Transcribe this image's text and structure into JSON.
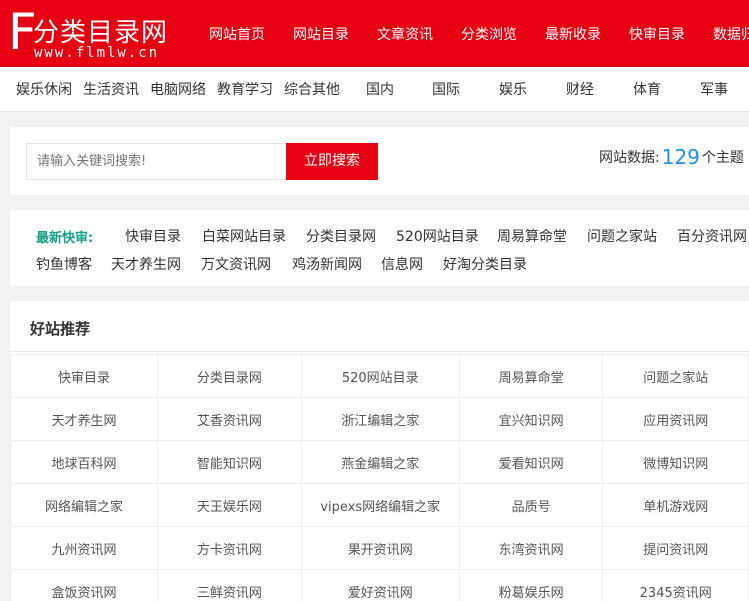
{
  "header": {
    "logo_letter": "F",
    "logo_title": "分类目录网",
    "logo_url": "www.flmlw.cn",
    "nav": [
      "网站首页",
      "网站目录",
      "文章资讯",
      "分类浏览",
      "最新收录",
      "快审目录",
      "数据归档"
    ]
  },
  "categories": [
    "娱乐休闲",
    "生活资讯",
    "电脑网络",
    "教育学习",
    "综合其他",
    "国内",
    "国际",
    "娱乐",
    "财经",
    "体育",
    "军事"
  ],
  "search": {
    "placeholder": "请输入关键词搜索!",
    "button": "立即搜索",
    "stats_label": "网站数据:",
    "stats_count": "129",
    "stats_suffix": "个主题"
  },
  "latest": {
    "label": "最新快审:",
    "links": [
      "快审目录",
      "白菜网站目录",
      "分类目录网",
      "520网站目录",
      "周易算命堂",
      "问题之家站",
      "百分资讯网",
      "钓鱼博客",
      "天才养生网",
      "万文资讯网",
      "鸡汤新闻网",
      "信息网",
      "好淘分类目录"
    ]
  },
  "recommend": {
    "title": "好站推荐",
    "rows": [
      [
        "快审目录",
        "分类目录网",
        "520网站目录",
        "周易算命堂",
        "问题之家站"
      ],
      [
        "天才养生网",
        "艾香资讯网",
        "浙江编辑之家",
        "宜兴知识网",
        "应用资讯网"
      ],
      [
        "地球百科网",
        "智能知识网",
        "燕金编辑之家",
        "爱看知识网",
        "微博知识网"
      ],
      [
        "网络编辑之家",
        "天王娱乐网",
        "vipexs网络编辑之家",
        "品质号",
        "单机游戏网"
      ],
      [
        "九州资讯网",
        "方卡资讯网",
        "果开资讯网",
        "东湾资讯网",
        "提问资讯网"
      ],
      [
        "盒饭资讯网",
        "三鲜资讯网",
        "爱好资讯网",
        "粉葛娱乐网",
        "2345资讯网"
      ]
    ]
  }
}
